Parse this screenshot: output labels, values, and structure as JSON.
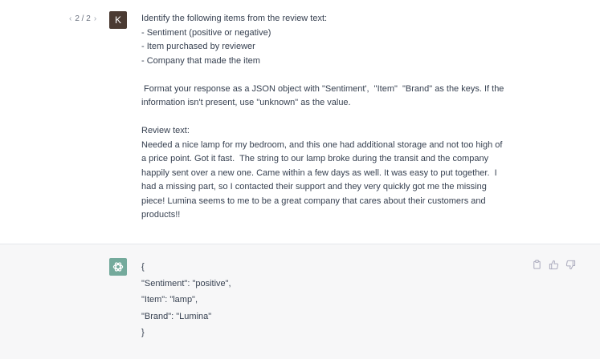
{
  "pager": {
    "prev_icon": "‹",
    "label": "2 / 2",
    "next_icon": "›"
  },
  "user": {
    "avatar_letter": "K"
  },
  "user_message": {
    "lines": [
      "Identify the following items from the review text:",
      "- Sentiment (positive or negative)",
      "- Item purchased by reviewer",
      "- Company that made the item",
      "",
      " Format your response as a JSON object with \"Sentiment',  \"Item\"  \"Brand\" as the keys. If the",
      "information isn't present, use \"unknown\" as the value.",
      "",
      "Review text:",
      "Needed a nice lamp for my bedroom, and this one had additional storage and not too high of",
      "a price point. Got it fast.  The string to our lamp broke during the transit and the company",
      "happily sent over a new one. Came within a few days as well. It was easy to put together.  I",
      "had a missing part, so I contacted their support and they very quickly got me the missing",
      "piece! Lumina seems to me to be a great company that cares about their customers and",
      "products!!"
    ]
  },
  "assistant_message": {
    "lines": [
      "{",
      "\"Sentiment\": \"positive\",",
      "\"Item\": \"lamp\",",
      "\"Brand\": \"Lumina\"",
      "}"
    ]
  },
  "actions": [
    "copy-icon",
    "thumbs-up-icon",
    "thumbs-down-icon"
  ],
  "colors": {
    "ai_avatar": "#74aa9c",
    "user_avatar": "#4b3b33",
    "assistant_bg": "#f7f7f8"
  }
}
